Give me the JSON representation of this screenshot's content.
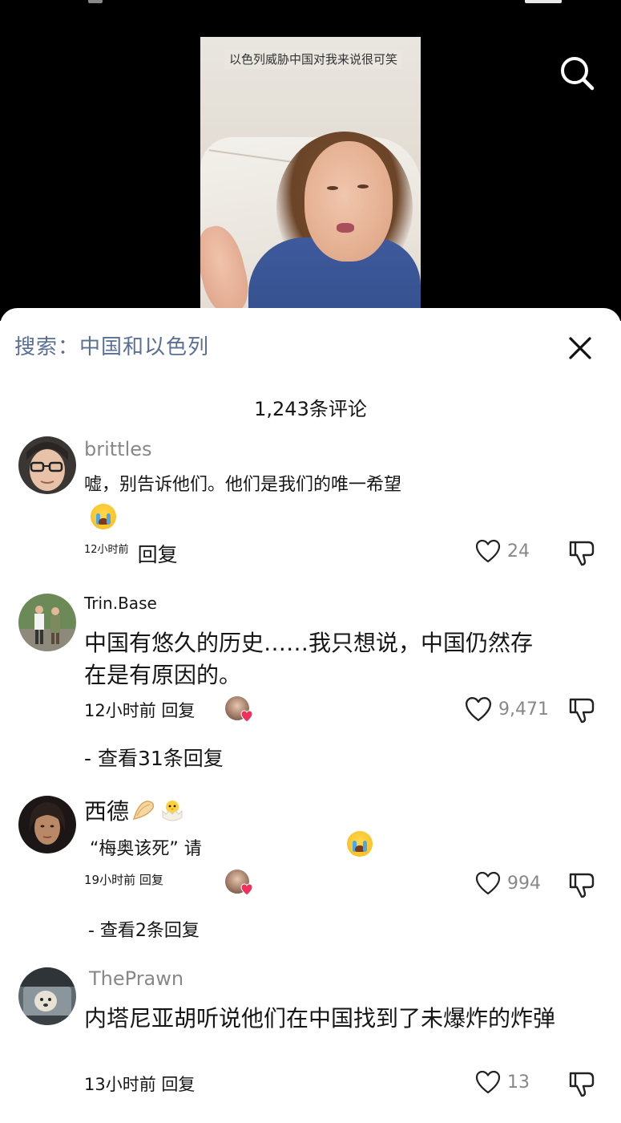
{
  "video": {
    "caption": "以色列威胁中国对我来说很可笑"
  },
  "sheet": {
    "search_label": "搜索：",
    "search_query": "中国和以色列",
    "comment_count": "1,243条评论"
  },
  "comments": [
    {
      "username": "brittles",
      "text": "嘘，别告诉他们。他们是我们的唯一希望",
      "emoji": "loudly-crying-face",
      "time": "12小时前",
      "reply_label": "回复",
      "likes": "24"
    },
    {
      "username": "Trin.Base",
      "text_line1": "中国有悠久的历史……我只想说，中国仍然存",
      "text_line2": "在是有原因的。",
      "time_reply": "12小时前 回复",
      "likes": "9,471",
      "view_replies": "- 查看31条回复"
    },
    {
      "username": "西德",
      "username_emojis": [
        "folded-hands",
        "hatching-chick"
      ],
      "text": "“梅奥该死” 请",
      "emoji": "loudly-crying-face",
      "time_reply": "19小时前 回复",
      "likes": "994",
      "view_replies": "- 查看2条回复"
    },
    {
      "username": "ThePrawn",
      "text": "内塔尼亚胡听说他们在中国找到了未爆炸的炸弹",
      "time_reply": "13小时前 回复",
      "likes": "13"
    }
  ],
  "colors": {
    "link_blue": "#5a6f95",
    "muted_gray": "#888888",
    "heart_red": "#f0305a"
  }
}
